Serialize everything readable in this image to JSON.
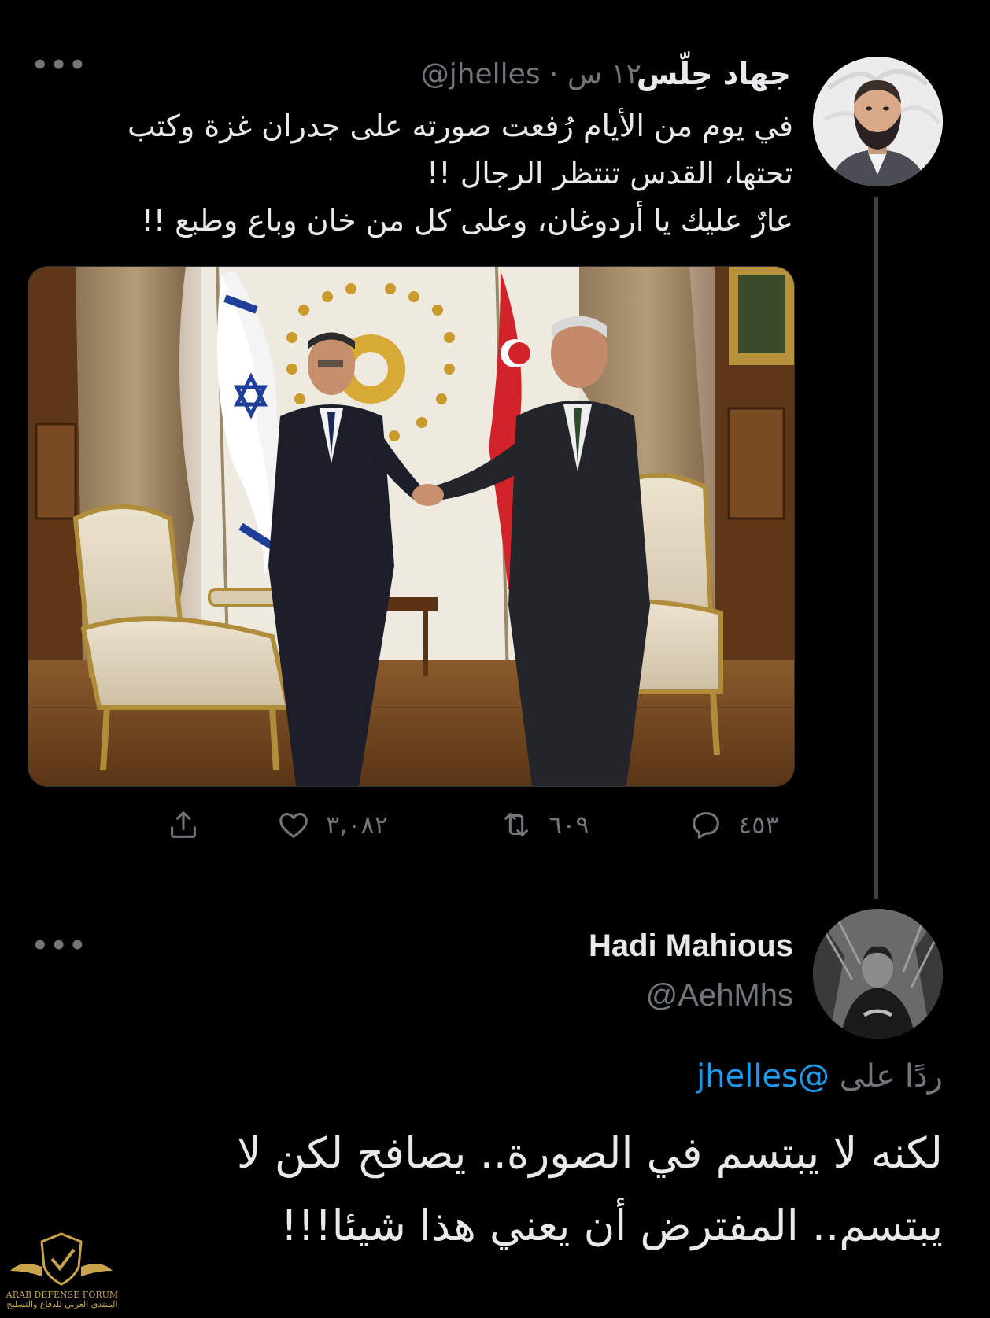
{
  "tweet1": {
    "display_name": "جهاد حِلّس",
    "handle": "@jhelles",
    "separator": "·",
    "time": "١٢ س",
    "lines": [
      "في يوم من الأيام رُفعت صورته على جدران غزة وكتب",
      "تحتها، القدس تنتظر الرجال !!",
      "عارٌ عليك يا أردوغان، وعلى كل من خان وباع وطبع !!"
    ],
    "counts": {
      "replies": "٤٥٣",
      "retweets": "٦٠٩",
      "likes": "٣,٠٨٢"
    }
  },
  "tweet2": {
    "display_name": "Hadi Mahious",
    "handle": "@AehMhs",
    "replying_prefix": "ردًا على",
    "replying_to": "@jhelles",
    "lines": [
      "لكنه لا يبتسم في الصورة.. يصافح لكن لا",
      "يبتسم.. المفترض أن يعني هذا شيئا!!!"
    ]
  },
  "more_label": "•••",
  "watermark": {
    "line1": "ARAB DEFENSE FORUM",
    "line2": "المنتدى العربي للدفاع والتسليح"
  },
  "colors": {
    "background": "#000000",
    "text": "#e7e9ea",
    "muted": "#71767b",
    "link": "#1d9bf0",
    "thread_line": "#3e4144"
  },
  "icons": [
    "reply-icon",
    "retweet-icon",
    "like-icon",
    "share-icon",
    "more-icon"
  ]
}
